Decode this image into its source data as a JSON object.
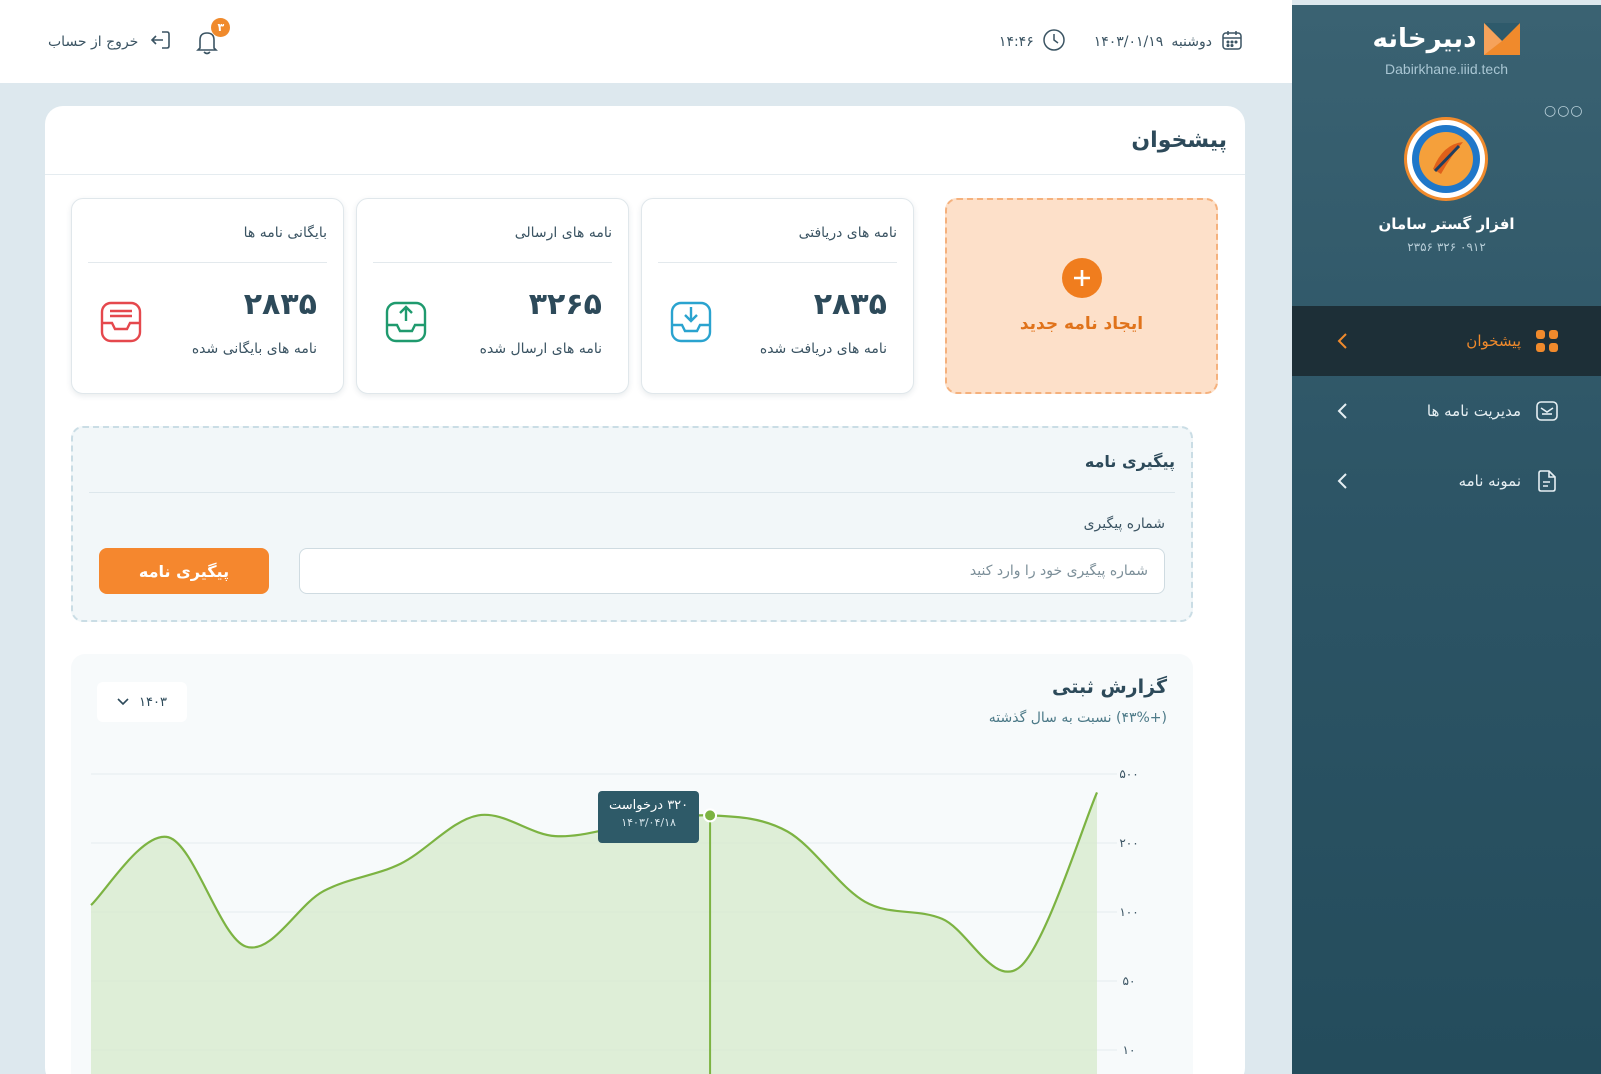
{
  "brand": {
    "name": "دبیرخانه",
    "url": "Dabirkhane.iiid.tech"
  },
  "profile": {
    "name": "افزار گستر سامان",
    "phone": "۰۹۱۲ ۳۲۶ ۲۳۵۶"
  },
  "nav": [
    {
      "label": "پیشخوان",
      "icon": "grid-icon",
      "active": true
    },
    {
      "label": "مدیریت نامه ها",
      "icon": "letter-manage-icon",
      "active": false
    },
    {
      "label": "نمونه نامه",
      "icon": "document-icon",
      "active": false
    }
  ],
  "topbar": {
    "logout_label": "خروج از حساب",
    "notification_count": "۳",
    "day": "دوشنبه",
    "date": "۱۴۰۳/۰۱/۱۹",
    "time": "۱۴:۴۶"
  },
  "page": {
    "title": "پیشخوان"
  },
  "new_letter": {
    "label": "ایجاد نامه جدید"
  },
  "stats": [
    {
      "title": "نامه های دریافتی",
      "value": "۲۸۳۵",
      "sub": "نامه های دریافت شده",
      "color": "#2aa3cf",
      "icon": "inbox-download-icon"
    },
    {
      "title": "نامه های ارسالی",
      "value": "۳۲۶۵",
      "sub": "نامه های ارسال شده",
      "color": "#1f9a6e",
      "icon": "inbox-upload-icon"
    },
    {
      "title": "بایگانی نامه ها",
      "value": "۲۸۳۵",
      "sub": "نامه های بایگانی شده",
      "color": "#e5484d",
      "icon": "archive-icon"
    }
  ],
  "tracking": {
    "title": "پیگیری نامه",
    "field_label": "شماره پیگیری",
    "placeholder": "شماره پیگیری خود را وارد کنید",
    "button_label": "پیگیری نامه"
  },
  "report": {
    "title": "گزارش ثبتی",
    "subtitle": "(+۴۳%) نسبت به سال گذشته",
    "year": "۱۴۰۳"
  },
  "chart_data": {
    "type": "area",
    "y_tick_labels": [
      "۵۰۰",
      "۲۰۰",
      "۱۰۰",
      "۵۰",
      "۱۰"
    ],
    "y_ticks": [
      500,
      200,
      100,
      50,
      10
    ],
    "values": [
      110,
      225,
      75,
      130,
      170,
      320,
      230,
      280,
      320,
      250,
      115,
      95,
      60,
      420
    ],
    "tooltip": {
      "value_label": "۳۲۰ درخواست",
      "date": "۱۴۰۳/۰۴/۱۸",
      "index": 8
    },
    "line_color": "#7cb342",
    "fill_color": "#d6eacb",
    "grid": true
  }
}
